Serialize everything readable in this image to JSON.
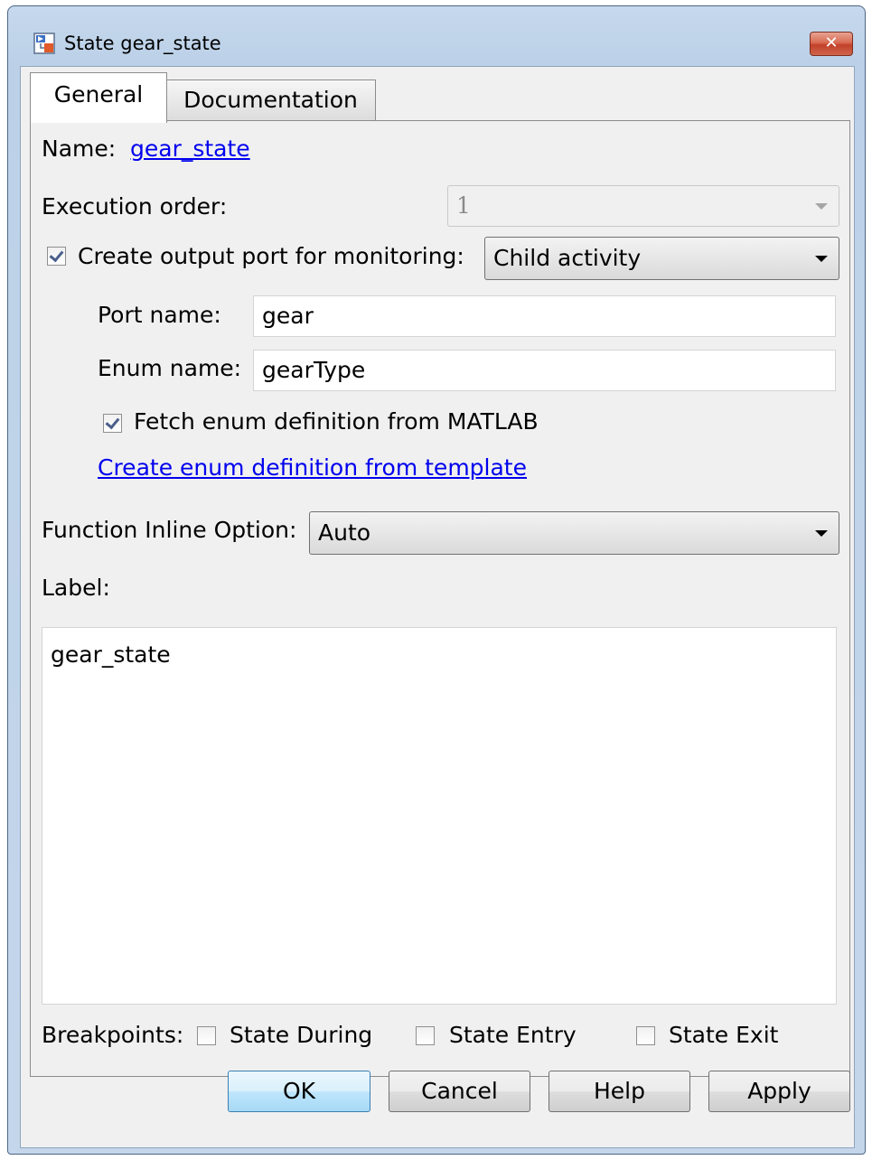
{
  "window": {
    "title": "State gear_state",
    "close_glyph": "✕",
    "icon": "stateflow-state-icon"
  },
  "tabs": [
    {
      "label": "General",
      "selected": true
    },
    {
      "label": "Documentation",
      "selected": false
    }
  ],
  "general": {
    "name_label": "Name:",
    "name_value": "gear_state",
    "execution_order_label": "Execution order:",
    "execution_order_value": "1",
    "create_output_port_label": "Create output port for monitoring:",
    "create_output_port_checked": true,
    "monitoring_value": "Child activity",
    "port_name_label": "Port name:",
    "port_name_value": "gear",
    "enum_name_label": "Enum name:",
    "enum_name_value": "gearType",
    "fetch_enum_label": "Fetch enum definition from MATLAB",
    "fetch_enum_checked": true,
    "create_enum_link": "Create enum definition from template",
    "function_inline_label": "Function Inline Option:",
    "function_inline_value": "Auto",
    "label_label": "Label:",
    "label_value": "gear_state",
    "breakpoints_label": "Breakpoints:",
    "breakpoints": [
      {
        "label": "State During",
        "checked": false
      },
      {
        "label": "State Entry",
        "checked": false
      },
      {
        "label": "State Exit",
        "checked": false
      }
    ]
  },
  "buttons": {
    "ok": "OK",
    "cancel": "Cancel",
    "help": "Help",
    "apply": "Apply"
  },
  "colors": {
    "link": "#0000ee",
    "default_button": "#bee6fd",
    "close_button": "#c2412a"
  }
}
